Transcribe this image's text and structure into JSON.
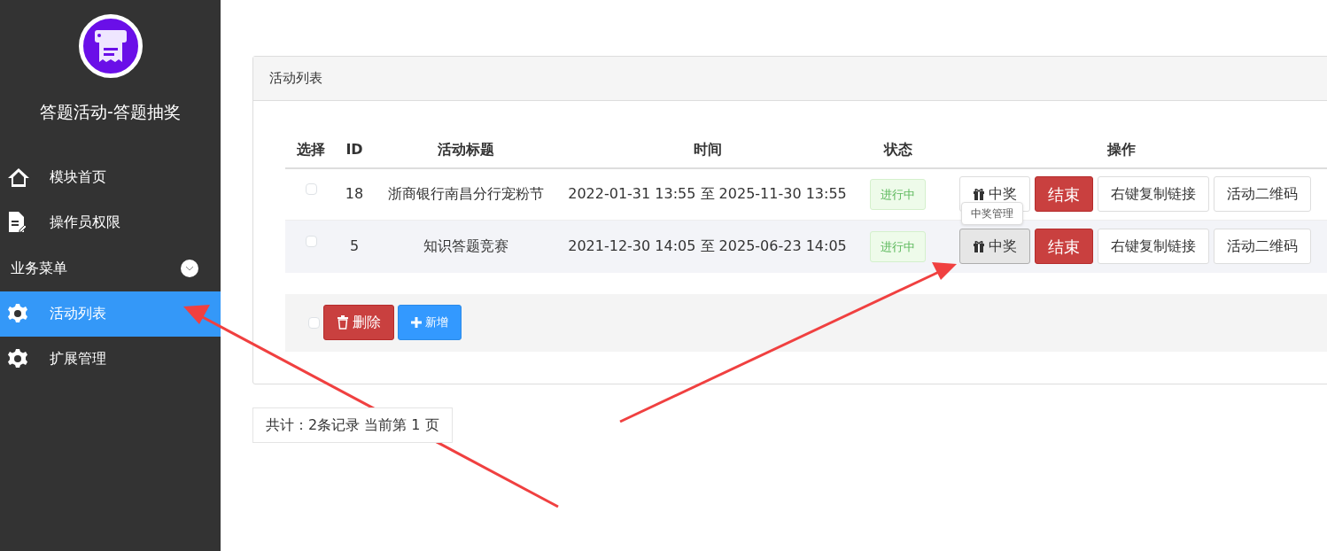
{
  "sidebar": {
    "title": "答题活动-答题抽奖",
    "items": [
      {
        "kind": "home-link",
        "label": "模块首页",
        "selected": false
      },
      {
        "kind": "document-link",
        "label": "操作员权限",
        "selected": false
      },
      {
        "kind": "section",
        "label": "业务菜单",
        "expanded": true
      },
      {
        "kind": "gear-link",
        "label": "活动列表",
        "selected": true
      },
      {
        "kind": "gear-link",
        "label": "扩展管理",
        "selected": false
      }
    ]
  },
  "panel": {
    "title": "活动列表",
    "table": {
      "columns": [
        "选择",
        "ID",
        "活动标题",
        "时间",
        "状态",
        "操作"
      ],
      "rows": [
        {
          "checked": false,
          "id": "18",
          "title": "浙商银行南昌分行宠粉节",
          "time": "2022-01-31 13:55 至 2025-11-30 13:55",
          "status": "进行中",
          "actions": [
            {
              "kind": "prize",
              "label": "中奖",
              "hovered": false
            },
            {
              "kind": "end",
              "label": "结束",
              "hovered": false
            },
            {
              "kind": "plain",
              "label": "右键复制链接",
              "hovered": false
            },
            {
              "kind": "plain",
              "label": "活动二维码",
              "hovered": false
            }
          ]
        },
        {
          "checked": false,
          "id": "5",
          "title": "知识答题竞赛",
          "time": "2021-12-30 14:05 至 2025-06-23 14:05",
          "status": "进行中",
          "actions": [
            {
              "kind": "prize",
              "label": "中奖",
              "hovered": true,
              "tooltip": "中奖管理"
            },
            {
              "kind": "end",
              "label": "结束",
              "hovered": false
            },
            {
              "kind": "plain",
              "label": "右键复制链接",
              "hovered": false
            },
            {
              "kind": "plain",
              "label": "活动二维码",
              "hovered": false
            }
          ]
        }
      ]
    },
    "footer": {
      "checked": false,
      "buttons": [
        {
          "kind": "delete",
          "label": "删除"
        },
        {
          "kind": "add",
          "label": "新增"
        }
      ]
    }
  },
  "pagination": "共计：2条记录 当前第 1 页"
}
